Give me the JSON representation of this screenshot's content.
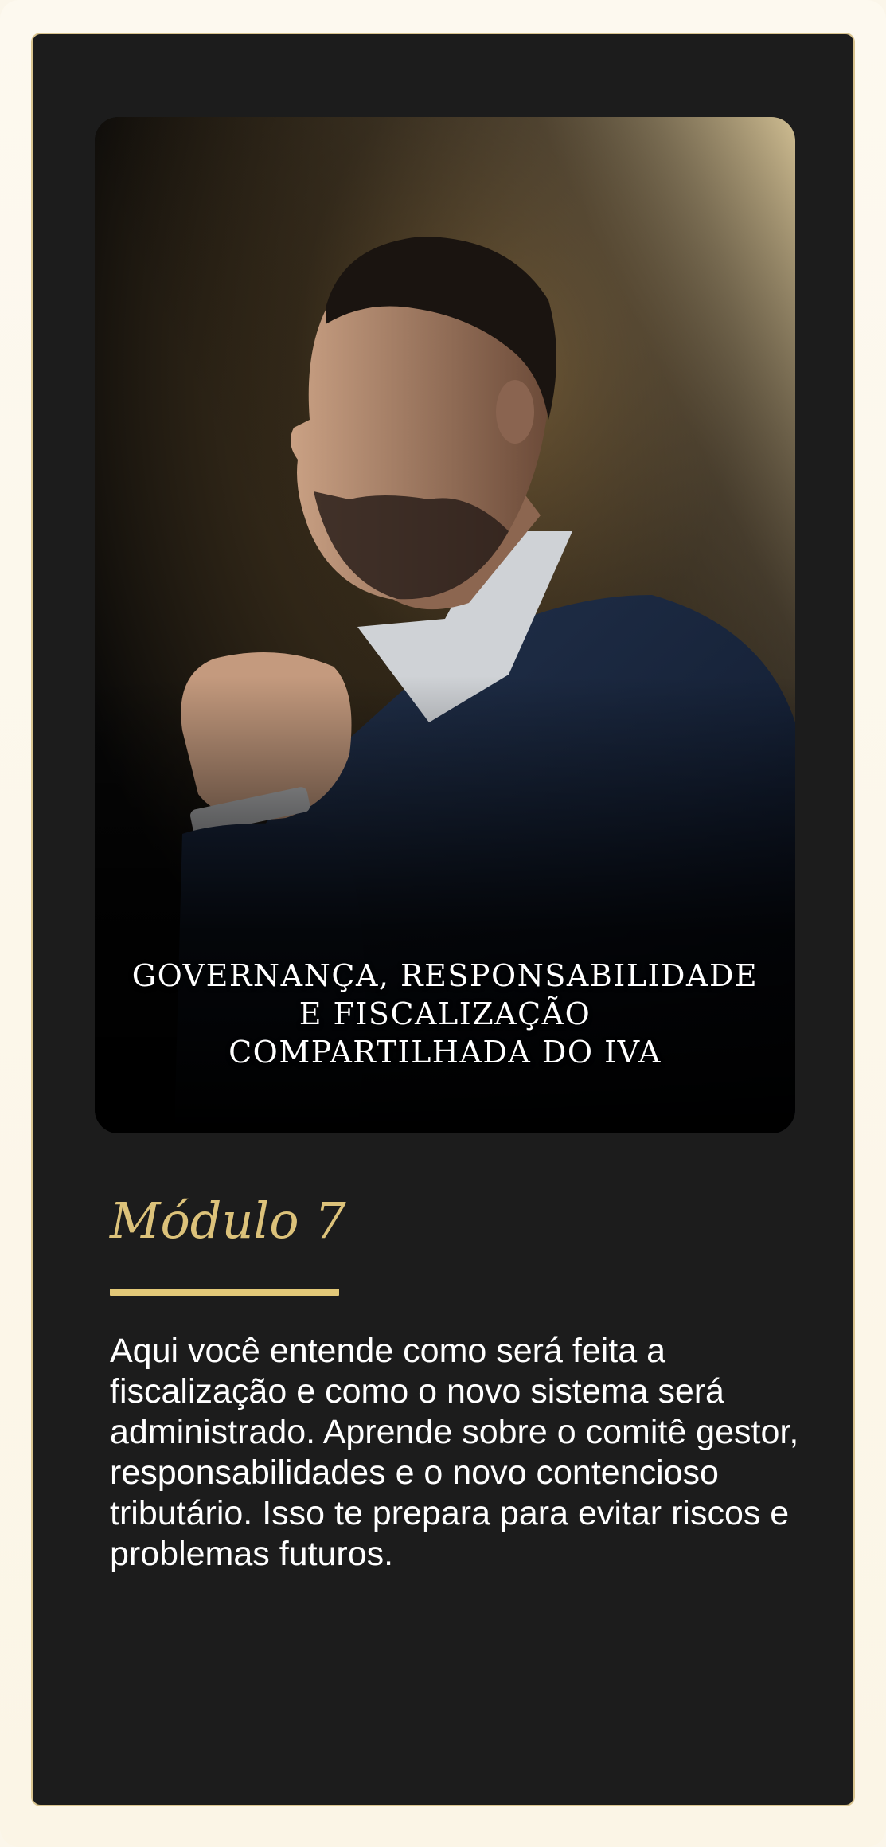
{
  "cover": {
    "image_subject": "man-in-navy-suit-portrait",
    "title_lines": [
      "GOVERNANÇA, RESPONSABILIDADE",
      "E FISCALIZAÇÃO",
      "COMPARTILHADA DO IVA"
    ]
  },
  "module": {
    "title": "Módulo 7",
    "description": "Aqui você entende como será feita a fiscalização e como o novo sistema será administrado. Aprende sobre o comitê gestor, responsabilidades e o novo contencioso tributário. Isso te prepara para evitar riscos e problemas futuros."
  },
  "colors": {
    "page_background": "#fbf6ea",
    "card_background": "#1c1c1c",
    "card_border": "#d9c48f",
    "accent_gold": "#dcc27a",
    "text": "#ffffff"
  }
}
